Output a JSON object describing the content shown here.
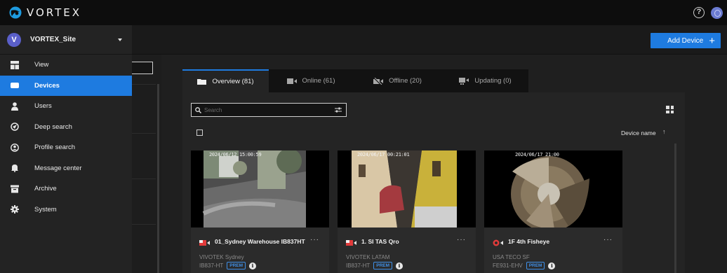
{
  "app": {
    "brand": "VORTEX"
  },
  "colors": {
    "accent": "#1e7be0",
    "topbar": "#0d0d0d",
    "sidebar": "#232323",
    "prem": "#3f8fe6"
  },
  "header": {
    "help_icon": "help-icon",
    "user_icon": "user-icon",
    "help_glyph": "?"
  },
  "toolbar": {
    "add_device_label": "Add Device",
    "add_device_glyph": "+"
  },
  "sidebar": {
    "site": {
      "initial": "V",
      "name": "VORTEX_Site"
    },
    "items": [
      {
        "label": "View",
        "icon": "view-icon",
        "active": false
      },
      {
        "label": "Devices",
        "icon": "devices-icon",
        "active": true
      },
      {
        "label": "Users",
        "icon": "users-icon",
        "active": false
      },
      {
        "label": "Deep search",
        "icon": "deep-search-icon",
        "active": false
      },
      {
        "label": "Profile search",
        "icon": "profile-search-icon",
        "active": false
      },
      {
        "label": "Message center",
        "icon": "bell-icon",
        "active": false
      },
      {
        "label": "Archive",
        "icon": "archive-icon",
        "active": false
      },
      {
        "label": "System",
        "icon": "gear-icon",
        "active": false
      }
    ]
  },
  "tabs": [
    {
      "label": "Overview (81)",
      "icon": "folder-icon"
    },
    {
      "label": "Online (61)",
      "icon": "camera-icon"
    },
    {
      "label": "Offline (20)",
      "icon": "camera-off-icon"
    },
    {
      "label": "Updating (0)",
      "icon": "camera-update-icon"
    }
  ],
  "search": {
    "placeholder": "Search",
    "value": ""
  },
  "list": {
    "sort_label": "Device name",
    "sort_glyph": "↑"
  },
  "cards": [
    {
      "timestamp": "2024/06/12 15:00:59",
      "title": "01_Sydney Warehouse IB837HT",
      "org": "VIVOTEK Sydney",
      "model": "IB837-HT",
      "badge": "PREM",
      "more": "···",
      "info": "i"
    },
    {
      "timestamp": "2024/06/17 00:21:01",
      "title": "1. SI TAS Qro",
      "org": "VIVOTEK LATAM",
      "model": "IB837-HT",
      "badge": "PREM",
      "more": "···",
      "info": "i"
    },
    {
      "timestamp": "2024/06/17 21:00",
      "title": "1F 4th Fisheye",
      "org": "USA TECO SF",
      "model": "FE931-EHV",
      "badge": "PREM",
      "more": "···",
      "info": "i"
    }
  ]
}
